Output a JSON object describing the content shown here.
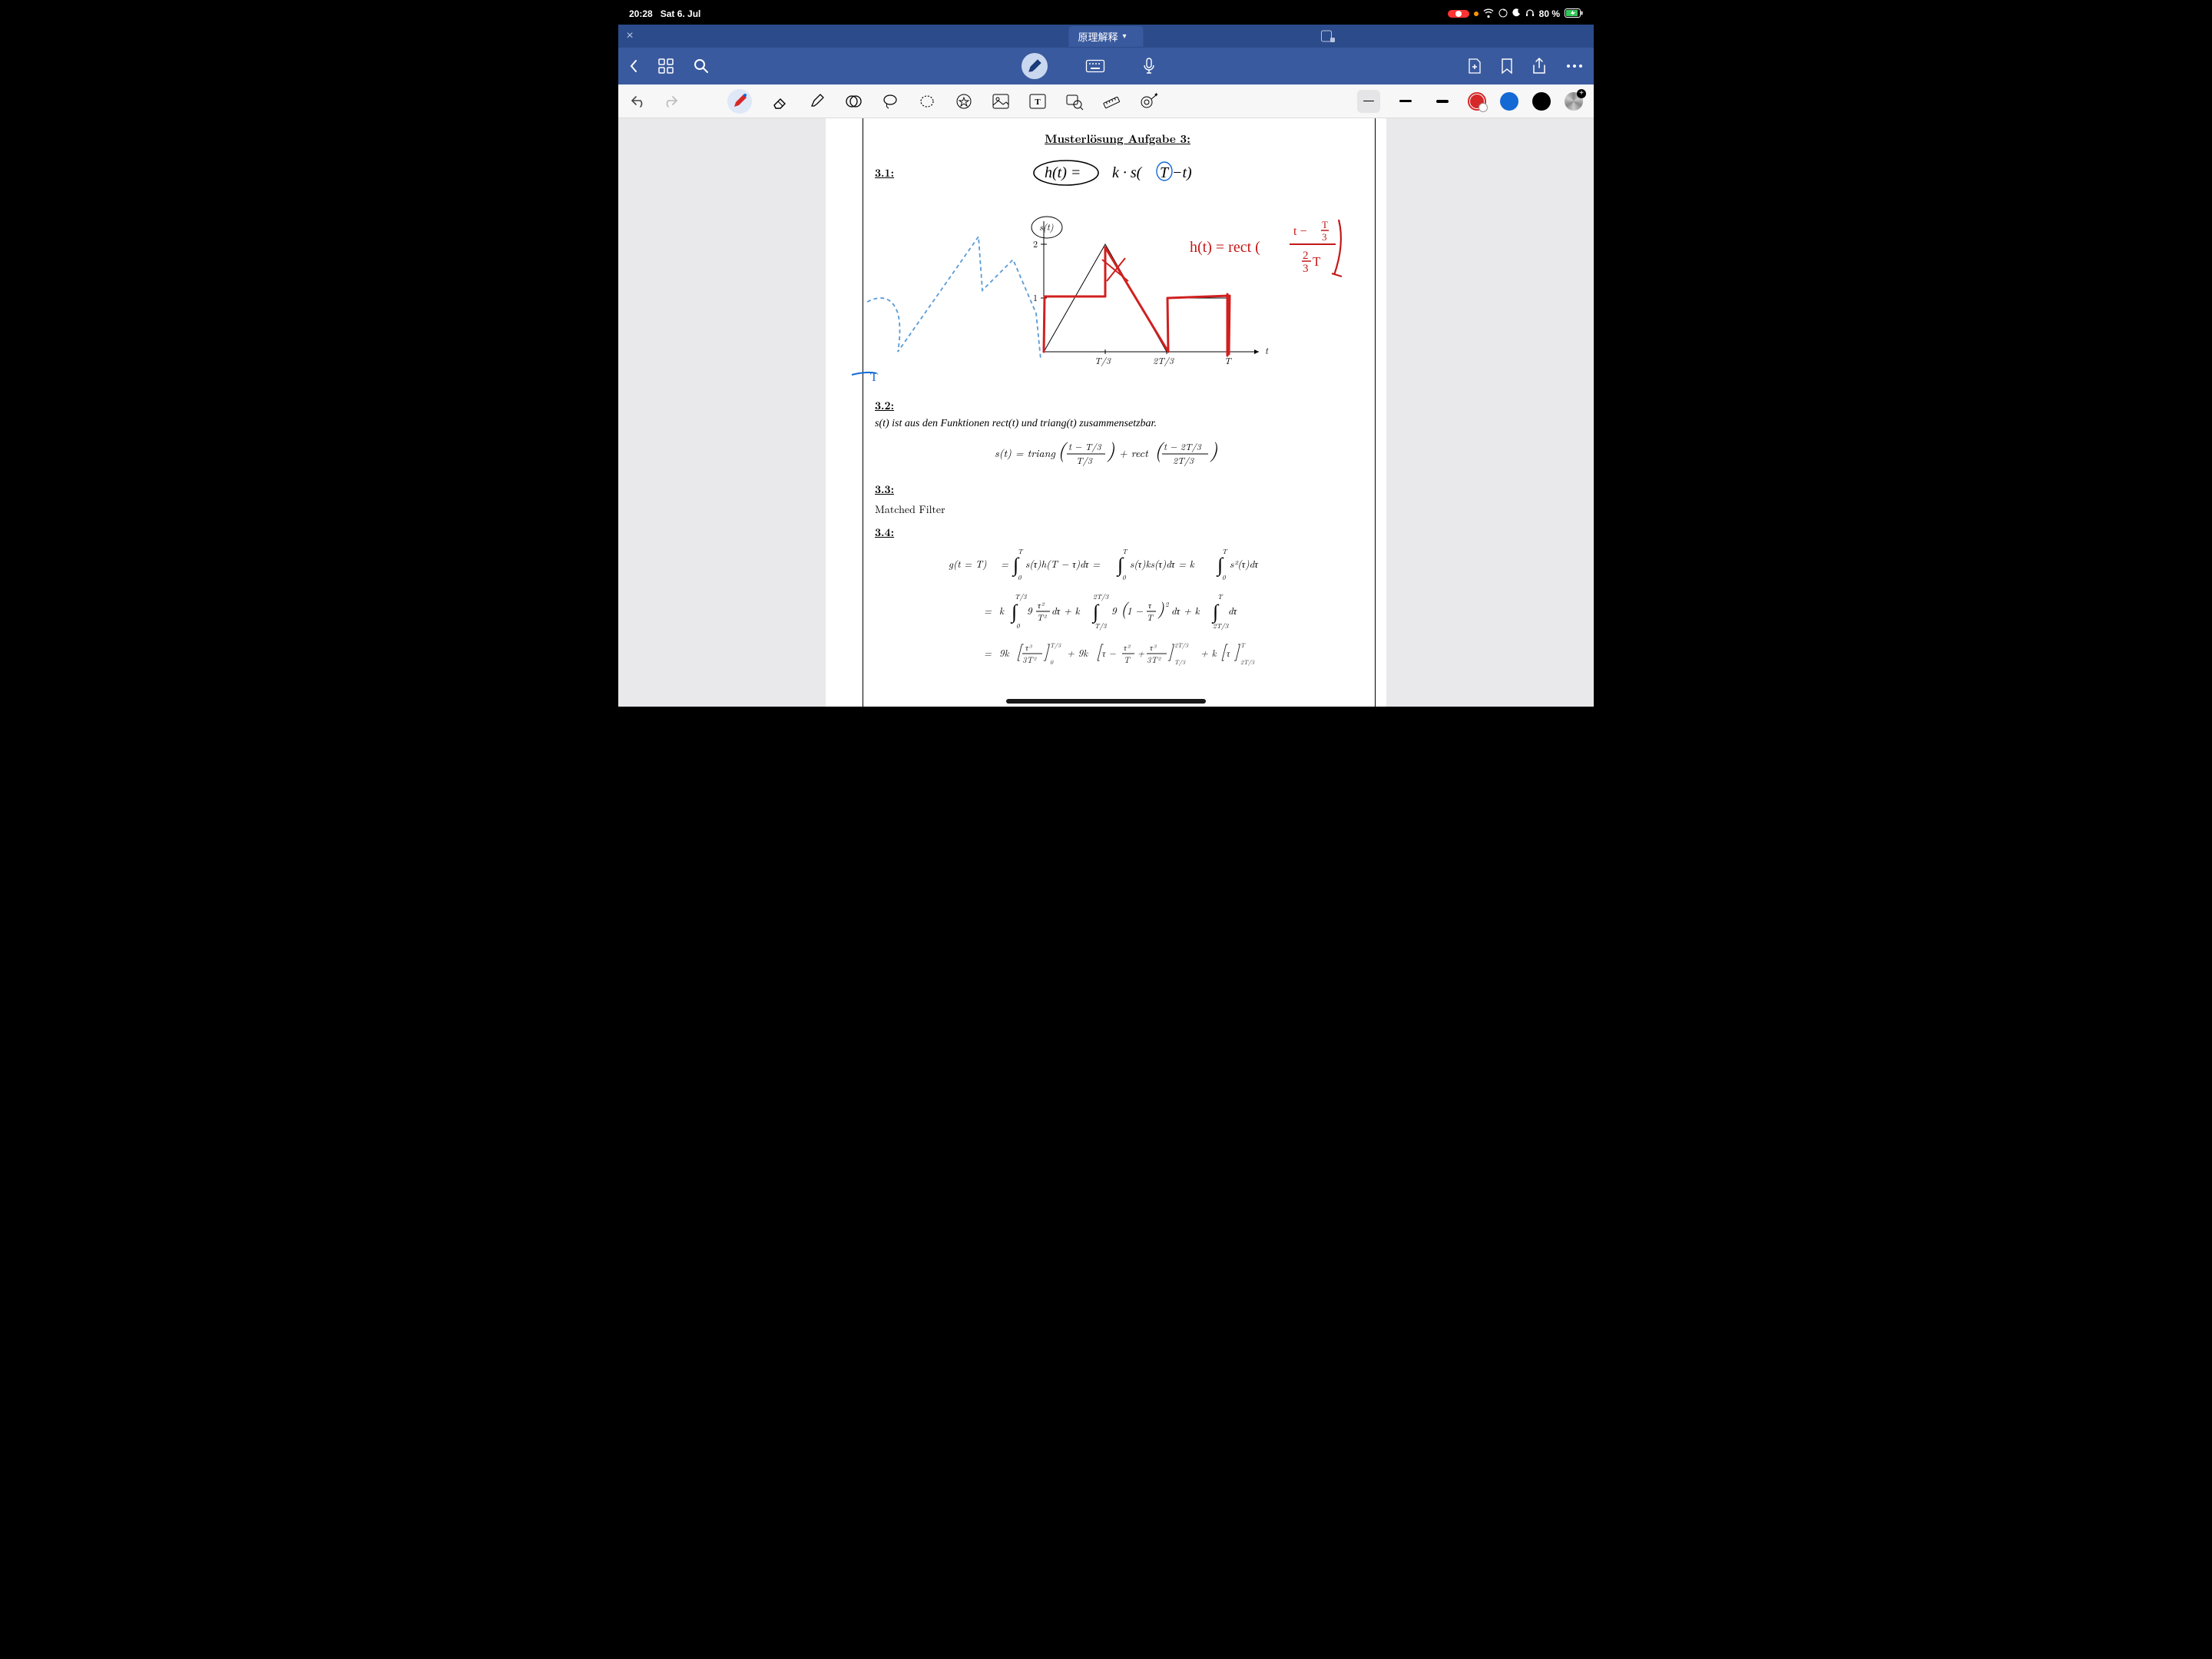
{
  "status": {
    "time": "20:28",
    "date": "Sat 6. Jul",
    "battery": "80 %"
  },
  "tab": {
    "title": "原理解释"
  },
  "document": {
    "title": "Musterlösung Aufgabe 3:",
    "sec31": "3.1:",
    "handwriting_top": "h(t) = k · s(T−t)",
    "handwriting_side": "h(t) = rect( (t − T/3) / (2T/3) )",
    "sec32": "3.2:",
    "text32": "s(t) ist aus den Funktionen rect(t) und triang(t) zusammensetzbar.",
    "eq32": "s(t) = triang( (t − T/3) / (T/3) ) + rect( (t − 2T/3) / (2T/3) )",
    "sec33": "3.3:",
    "text33": "Matched Filter",
    "sec34": "3.4:",
    "eq34a": "g(t = T)  =  ∫₀ᵀ s(τ) h(T − τ) dτ  =  ∫₀ᵀ s(τ) k s(τ) dτ  =  k ∫₀ᵀ s²(τ) dτ",
    "eq34b": "=  k ∫₀^{T/3} 9 τ²/T² dτ  +  k ∫_{T/3}^{2T/3} 9 (1 − τ/T)² dτ  +  k ∫_{2T/3}^{T} dτ",
    "eq34c": "=  9k [ τ³ / 3T² ]₀^{T/3}  +  9k [ τ − τ²/T + τ³/3T² ]_{T/3}^{2T/3}  +  k [ τ ]_{2T/3}^{T}"
  },
  "chart_data": {
    "type": "line",
    "title": "s(t)",
    "xlabel": "t",
    "ylabel": "s(t)",
    "xlim": [
      0,
      1
    ],
    "ylim": [
      0,
      2
    ],
    "x_ticks": [
      "0",
      "T/3",
      "2T/3",
      "T"
    ],
    "y_ticks": [
      1,
      2
    ],
    "series": [
      {
        "name": "s(t) printed",
        "points": [
          [
            0,
            0
          ],
          [
            0.333,
            2
          ],
          [
            0.667,
            0
          ],
          [
            0.667,
            1
          ],
          [
            1,
            1
          ],
          [
            1,
            0
          ]
        ]
      },
      {
        "name": "h(t) handwritten (red)",
        "color": "#d62828",
        "points": [
          [
            0,
            0
          ],
          [
            0,
            1
          ],
          [
            0.333,
            1
          ],
          [
            0.333,
            2
          ],
          [
            0.667,
            0
          ],
          [
            0.667,
            1
          ],
          [
            1,
            1
          ],
          [
            1,
            0
          ]
        ]
      }
    ]
  }
}
